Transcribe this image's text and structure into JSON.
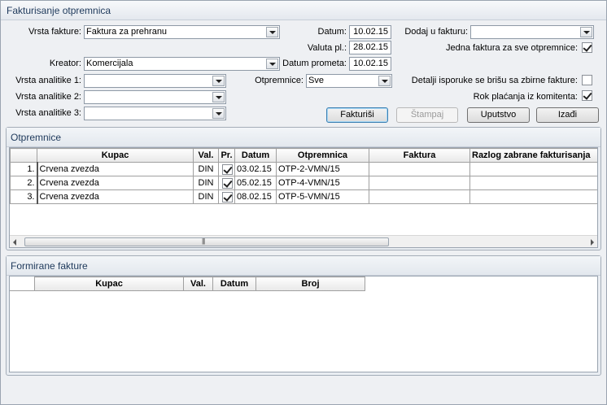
{
  "window": {
    "title": "Fakturisanje otpremnica"
  },
  "form": {
    "vrsta_fakture": {
      "label": "Vrsta fakture:",
      "value": "Faktura za prehranu"
    },
    "kreator": {
      "label": "Kreator:",
      "value": "Komercijala"
    },
    "analitika1": {
      "label": "Vrsta analitike 1:",
      "value": ""
    },
    "analitika2": {
      "label": "Vrsta analitike 2:",
      "value": ""
    },
    "analitika3": {
      "label": "Vrsta analitike 3:",
      "value": ""
    },
    "datum": {
      "label": "Datum:",
      "value": "10.02.15"
    },
    "valuta": {
      "label": "Valuta pl.:",
      "value": "28.02.15"
    },
    "datum_prometa": {
      "label": "Datum prometa:",
      "value": "10.02.15"
    },
    "otpremnice": {
      "label": "Otpremnice:",
      "value": "Sve"
    },
    "dodaj_u_fakturu": {
      "label": "Dodaj u fakturu:",
      "value": ""
    },
    "jedna_faktura": {
      "label": "Jedna faktura za sve otpremnice:",
      "checked": true
    },
    "detalji_isporuke": {
      "label": "Detalji isporuke se brišu sa zbirne fakture:",
      "checked": false
    },
    "rok_placanja": {
      "label": "Rok plaćanja iz komitenta:",
      "checked": true
    }
  },
  "buttons": {
    "fakturisi": "Fakturiši",
    "stampaj": "Štampaj",
    "uputstvo": "Uputstvo",
    "izadji": "Izađi"
  },
  "otpremnice_panel": {
    "title": "Otpremnice",
    "columns": [
      "Kupac",
      "Val.",
      "Pr.",
      "Datum",
      "Otpremnica",
      "Faktura",
      "Razlog zabrane fakturisanja"
    ],
    "rows": [
      {
        "num": "1.",
        "kupac": "Crvena zvezda",
        "val": "DIN",
        "pr": true,
        "datum": "03.02.15",
        "otpremnica": "OTP-2-VMN/15",
        "faktura": "",
        "razlog": ""
      },
      {
        "num": "2.",
        "kupac": "Crvena zvezda",
        "val": "DIN",
        "pr": true,
        "datum": "05.02.15",
        "otpremnica": "OTP-4-VMN/15",
        "faktura": "",
        "razlog": ""
      },
      {
        "num": "3.",
        "kupac": "Crvena zvezda",
        "val": "DIN",
        "pr": true,
        "datum": "08.02.15",
        "otpremnica": "OTP-5-VMN/15",
        "faktura": "",
        "razlog": ""
      }
    ]
  },
  "fakture_panel": {
    "title": "Formirane fakture",
    "columns": [
      "Kupac",
      "Val.",
      "Datum",
      "Broj"
    ]
  },
  "icons": {
    "combo_arrow": "chevron-down-icon",
    "checkbox": "check-icon",
    "scroll_left": "arrow-left-icon",
    "scroll_right": "arrow-right-icon"
  }
}
